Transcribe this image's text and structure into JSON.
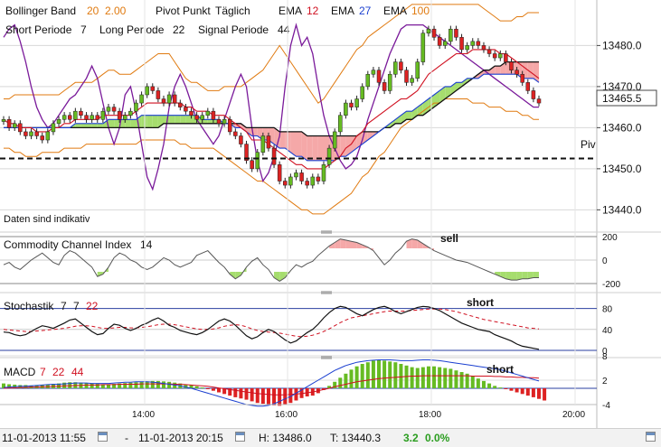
{
  "legend": {
    "bb_label": "Bollinger Band",
    "bb_p1": "20",
    "bb_p2": "2.00",
    "pivot_label": "Pivot Punkt",
    "pivot_freq": "Täglich",
    "ema_label": "EMA",
    "ema_p1": "12",
    "ema_p2": "27",
    "ema_p3": "100",
    "short_label": "Short Periode",
    "short_val": "7",
    "long_label": "Long Periode",
    "long_val": "22",
    "signal_label": "Signal Periode",
    "signal_val": "44",
    "note": "Daten sind indikativ",
    "pivot_tag": "Piv",
    "current_price": "13465.5"
  },
  "colors": {
    "bb": "#e07a10",
    "ema12": "#d01020",
    "ema27": "#1a3fd0",
    "ema100": "#111111",
    "signal": "#7a1a9a",
    "up": "#66bb22",
    "down": "#dd2222",
    "cloud_up": "#a6dd6e",
    "cloud_down": "#f5a8a8",
    "grid": "#d8d8d8"
  },
  "cci_panel": {
    "label": "Commodity Channel Index",
    "period": "14",
    "annotation": "sell",
    "ticks": [
      "200",
      "0",
      "-200"
    ]
  },
  "stoch_panel": {
    "label": "Stochastik",
    "p1": "7",
    "p2": "7",
    "p3": "22",
    "annotation": "short",
    "ticks": [
      "80",
      "40",
      "0"
    ]
  },
  "macd_panel": {
    "label": "MACD",
    "p1": "7",
    "p2": "22",
    "p3": "44",
    "annotation": "short",
    "ticks": [
      "8",
      "2",
      "-4"
    ]
  },
  "x_ticks": [
    "14:00",
    "16:00",
    "18:00",
    "20:00"
  ],
  "status": {
    "from": "11-01-2013 11:55",
    "dash": "-",
    "to": "11-01-2013 20:15",
    "high": "H: 13486.0",
    "low": "T: 13440.3",
    "change": "3.2",
    "change_pct": "0.0%"
  },
  "chart_data": {
    "type": "line",
    "title": "",
    "xlabel": "",
    "ylabel": "",
    "x_range": [
      "11:55",
      "20:15"
    ],
    "ylim": [
      13437,
      13488
    ],
    "y_ticks": [
      13440.0,
      13450.0,
      13460.0,
      13470.0,
      13480.0
    ],
    "y_tick_labels": [
      "13440.0",
      "13450.0",
      "13460.0",
      "13470.0",
      "13480.0"
    ],
    "pivot": 13452.5,
    "current_price": 13465.5,
    "candles_close": [
      13462,
      13460,
      13461,
      13459,
      13458,
      13459,
      13458,
      13457,
      13459,
      13461,
      13462,
      13463,
      13462,
      13464,
      13463,
      13462,
      13463,
      13462,
      13464,
      13465,
      13464,
      13462,
      13463,
      13464,
      13466,
      13468,
      13470,
      13469,
      13467,
      13466,
      13468,
      13466,
      13465,
      13464,
      13463,
      13462,
      13463,
      13464,
      13462,
      13461,
      13462,
      13459,
      13458,
      13456,
      13452,
      13450,
      13454,
      13458,
      13455,
      13451,
      13447,
      13446,
      13448,
      13449,
      13447,
      13446,
      13448,
      13447,
      13451,
      13455,
      13459,
      13463,
      13466,
      13465,
      13467,
      13470,
      13473,
      13474,
      13471,
      13469,
      13473,
      13476,
      13474,
      13471,
      13472,
      13476,
      13483,
      13484,
      13482,
      13480,
      13481,
      13484,
      13482,
      13479,
      13480,
      13481,
      13480,
      13479,
      13478,
      13477,
      13478,
      13476,
      13474,
      13473,
      13471,
      13469,
      13467,
      13466
    ],
    "bb_upper": [
      13467,
      13467,
      13468,
      13468,
      13468,
      13468,
      13468,
      13468,
      13468,
      13468,
      13468,
      13469,
      13470,
      13471,
      13471,
      13471,
      13471,
      13472,
      13473,
      13474,
      13474,
      13473,
      13473,
      13473,
      13474,
      13475,
      13476,
      13477,
      13478,
      13478,
      13478,
      13476,
      13474,
      13472,
      13471,
      13471,
      13470,
      13469,
      13469,
      13469,
      13470,
      13470,
      13470,
      13470,
      13471,
      13472,
      13473,
      13474,
      13476,
      13478,
      13480,
      13478,
      13476,
      13474,
      13472,
      13470,
      13468,
      13466,
      13467,
      13469,
      13471,
      13473,
      13475,
      13477,
      13479,
      13480,
      13482,
      13483,
      13484,
      13485,
      13486,
      13487,
      13488,
      13489,
      13490,
      13490,
      13490,
      13490,
      13490,
      13490,
      13490,
      13490,
      13490,
      13490,
      13490,
      13490,
      13490,
      13489,
      13488,
      13487,
      13486,
      13486,
      13486,
      13487,
      13487,
      13488,
      13488,
      13488
    ],
    "bb_lower": [
      13455,
      13455,
      13454,
      13454,
      13453,
      13453,
      13453,
      13454,
      13454,
      13454,
      13454,
      13455,
      13455,
      13455,
      13455,
      13456,
      13456,
      13456,
      13456,
      13456,
      13456,
      13456,
      13456,
      13456,
      13456,
      13457,
      13457,
      13457,
      13457,
      13457,
      13457,
      13457,
      13456,
      13456,
      13455,
      13455,
      13455,
      13455,
      13455,
      13454,
      13453,
      13452,
      13451,
      13450,
      13449,
      13448,
      13447,
      13447,
      13446,
      13445,
      13444,
      13443,
      13442,
      13441,
      13440,
      13440,
      13439,
      13439,
      13439,
      13440,
      13441,
      13442,
      13443,
      13444,
      13446,
      13448,
      13449,
      13451,
      13453,
      13454,
      13456,
      13458,
      13460,
      13461,
      13462,
      13463,
      13464,
      13465,
      13466,
      13466,
      13467,
      13467,
      13467,
      13467,
      13467,
      13466,
      13466,
      13466,
      13465,
      13465,
      13465,
      13464,
      13464,
      13464,
      13463,
      13463,
      13462,
      13462
    ],
    "ema12": [
      13462,
      13461,
      13461,
      13460,
      13460,
      13460,
      13459,
      13459,
      13459,
      13460,
      13460,
      13461,
      13461,
      13462,
      13462,
      13462,
      13462,
      13462,
      13463,
      13463,
      13463,
      13463,
      13463,
      13463,
      13464,
      13465,
      13466,
      13466,
      13466,
      13466,
      13466,
      13466,
      13466,
      13465,
      13465,
      13464,
      13464,
      13464,
      13463,
      13463,
      13463,
      13462,
      13461,
      13460,
      13459,
      13457,
      13457,
      13457,
      13456,
      13455,
      13454,
      13453,
      13452,
      13451,
      13451,
      13450,
      13450,
      13450,
      13450,
      13451,
      13452,
      13453,
      13455,
      13456,
      13458,
      13459,
      13461,
      13462,
      13463,
      13464,
      13465,
      13466,
      13467,
      13467,
      13468,
      13469,
      13471,
      13473,
      13474,
      13475,
      13476,
      13477,
      13478,
      13478,
      13478,
      13479,
      13479,
      13479,
      13479,
      13479,
      13478,
      13478,
      13477,
      13476,
      13475,
      13474,
      13473,
      13472
    ],
    "ema27": [
      13460,
      13460,
      13460,
      13460,
      13460,
      13460,
      13460,
      13460,
      13460,
      13460,
      13460,
      13460,
      13460,
      13461,
      13461,
      13461,
      13461,
      13461,
      13461,
      13462,
      13462,
      13462,
      13462,
      13462,
      13462,
      13463,
      13463,
      13463,
      13463,
      13463,
      13463,
      13463,
      13463,
      13463,
      13463,
      13463,
      13462,
      13462,
      13462,
      13462,
      13461,
      13461,
      13460,
      13460,
      13459,
      13458,
      13458,
      13457,
      13457,
      13456,
      13455,
      13455,
      13454,
      13453,
      13453,
      13452,
      13452,
      13452,
      13452,
      13452,
      13452,
      13453,
      13453,
      13454,
      13455,
      13456,
      13457,
      13458,
      13459,
      13460,
      13461,
      13462,
      13463,
      13464,
      13464,
      13465,
      13466,
      13467,
      13468,
      13469,
      13470,
      13470,
      13471,
      13471,
      13472,
      13472,
      13472,
      13473,
      13473,
      13473,
      13473,
      13473,
      13473,
      13473,
      13472,
      13472,
      13472,
      13471
    ],
    "ema100": [
      13460,
      13460,
      13460,
      13460,
      13460,
      13460,
      13460,
      13460,
      13460,
      13460,
      13460,
      13460,
      13460,
      13460,
      13460,
      13460,
      13460,
      13460,
      13460,
      13460,
      13460,
      13460,
      13460,
      13460,
      13460,
      13460,
      13460,
      13460,
      13460,
      13461,
      13461,
      13461,
      13461,
      13461,
      13461,
      13461,
      13461,
      13461,
      13461,
      13461,
      13461,
      13461,
      13461,
      13461,
      13460,
      13460,
      13460,
      13460,
      13460,
      13460,
      13459,
      13459,
      13459,
      13459,
      13459,
      13458,
      13458,
      13458,
      13458,
      13458,
      13458,
      13458,
      13458,
      13458,
      13458,
      13459,
      13459,
      13459,
      13459,
      13460,
      13460,
      13461,
      13461,
      13462,
      13462,
      13463,
      13463,
      13464,
      13465,
      13466,
      13467,
      13468,
      13469,
      13470,
      13471,
      13472,
      13473,
      13474,
      13474,
      13475,
      13475,
      13476,
      13476,
      13476,
      13476,
      13476,
      13476,
      13476
    ],
    "signal_line": [
      13482,
      13484,
      13485,
      13481,
      13476,
      13470,
      13465,
      13462,
      13460,
      13461,
      13463,
      13465,
      13467,
      13468,
      13470,
      13472,
      13475,
      13472,
      13466,
      13460,
      13456,
      13460,
      13468,
      13470,
      13464,
      13456,
      13448,
      13445,
      13450,
      13456,
      13465,
      13470,
      13473,
      13470,
      13466,
      13462,
      13460,
      13458,
      13456,
      13458,
      13462,
      13466,
      13470,
      13473,
      13470,
      13460,
      13452,
      13447,
      13449,
      13453,
      13458,
      13470,
      13480,
      13485,
      13480,
      13482,
      13478,
      13470,
      13463,
      13458,
      13455,
      13452,
      13450,
      13451,
      13453,
      13457,
      13462,
      13466,
      13470,
      13474,
      13478,
      13481,
      13484,
      13485,
      13485,
      13485,
      13485,
      13484,
      13483,
      13482,
      13481,
      13480,
      13479,
      13478,
      13477,
      13476,
      13475,
      13474,
      13473,
      13472,
      13471,
      13470,
      13469,
      13468,
      13467,
      13466,
      13465,
      13465
    ],
    "cci": [
      -40,
      -20,
      -60,
      -80,
      -40,
      0,
      30,
      60,
      20,
      -20,
      -40,
      40,
      80,
      60,
      20,
      -20,
      -60,
      -140,
      -120,
      -60,
      20,
      60,
      40,
      0,
      -20,
      -60,
      -80,
      -60,
      -20,
      20,
      0,
      -40,
      -60,
      -40,
      -20,
      40,
      60,
      80,
      30,
      -20,
      -60,
      -120,
      -160,
      -130,
      -60,
      -10,
      20,
      -40,
      -80,
      -150,
      -180,
      -150,
      -90,
      -40,
      -60,
      -30,
      -10,
      40,
      80,
      120,
      150,
      180,
      170,
      160,
      150,
      130,
      110,
      80,
      20,
      -40,
      0,
      60,
      100,
      160,
      180,
      170,
      140,
      110,
      80,
      60,
      40,
      20,
      0,
      -10,
      -20,
      -40,
      -60,
      -80,
      -100,
      -120,
      -140,
      -160,
      -170,
      -170,
      -160,
      -160,
      -150,
      -150
    ],
    "stoch_k": [
      35,
      34,
      30,
      28,
      30,
      36,
      42,
      47,
      45,
      42,
      47,
      52,
      58,
      60,
      52,
      44,
      36,
      30,
      32,
      42,
      50,
      48,
      42,
      38,
      42,
      48,
      52,
      58,
      62,
      56,
      48,
      44,
      38,
      35,
      32,
      30,
      34,
      40,
      48,
      56,
      60,
      56,
      48,
      38,
      28,
      22,
      26,
      34,
      40,
      36,
      28,
      20,
      14,
      18,
      26,
      34,
      40,
      50,
      62,
      72,
      80,
      84,
      82,
      76,
      70,
      66,
      72,
      78,
      82,
      84,
      80,
      74,
      70,
      74,
      78,
      82,
      84,
      83,
      80,
      76,
      70,
      64,
      58,
      52,
      48,
      44,
      40,
      38,
      36,
      30,
      26,
      22,
      18,
      12,
      8,
      6,
      4,
      2
    ],
    "stoch_d": [
      40,
      39,
      38,
      37,
      36,
      36,
      37,
      38,
      39,
      40,
      41,
      42,
      44,
      46,
      47,
      47,
      46,
      44,
      42,
      42,
      43,
      44,
      44,
      43,
      43,
      44,
      45,
      47,
      49,
      50,
      50,
      49,
      47,
      45,
      43,
      41,
      40,
      40,
      41,
      43,
      46,
      48,
      49,
      48,
      45,
      41,
      38,
      36,
      35,
      34,
      33,
      31,
      29,
      27,
      26,
      27,
      29,
      32,
      36,
      41,
      47,
      53,
      58,
      62,
      64,
      66,
      68,
      70,
      72,
      74,
      75,
      75,
      75,
      75,
      76,
      77,
      78,
      79,
      79,
      79,
      78,
      76,
      74,
      71,
      68,
      65,
      62,
      59,
      57,
      55,
      53,
      51,
      49,
      47,
      45,
      43,
      42,
      41
    ],
    "macd_hist": [
      1.2,
      1.0,
      0.9,
      0.8,
      0.8,
      0.7,
      0.8,
      0.9,
      1.0,
      1.1,
      1.2,
      1.4,
      1.5,
      1.5,
      1.4,
      1.3,
      1.2,
      1.1,
      1.0,
      1.0,
      1.1,
      1.2,
      1.3,
      1.4,
      1.5,
      1.6,
      1.7,
      1.8,
      1.8,
      1.7,
      1.6,
      1.4,
      1.2,
      1.0,
      0.8,
      0.5,
      0.2,
      -0.2,
      -0.6,
      -1.0,
      -1.4,
      -1.8,
      -2.2,
      -2.5,
      -2.8,
      -3.2,
      -3.6,
      -3.8,
      -4.0,
      -4.2,
      -4.3,
      -4.0,
      -3.6,
      -3.0,
      -2.4,
      -2.0,
      -1.8,
      -1.2,
      -0.4,
      0.6,
      1.6,
      2.6,
      3.6,
      4.6,
      5.4,
      6.0,
      6.4,
      6.8,
      7.0,
      6.8,
      6.6,
      6.4,
      6.0,
      5.6,
      5.2,
      5.0,
      5.2,
      5.4,
      5.4,
      5.2,
      5.0,
      4.8,
      4.4,
      4.0,
      3.6,
      3.0,
      2.4,
      1.8,
      1.2,
      0.6,
      0.2,
      -0.2,
      -0.6,
      -1.0,
      -1.4,
      -1.8,
      -2.2,
      -2.6,
      -3.0
    ],
    "macd_line": [
      0.2,
      0.3,
      0.4,
      0.5,
      0.5,
      0.6,
      0.7,
      0.8,
      0.9,
      1.0,
      1.0,
      1.1,
      1.2,
      1.3,
      1.3,
      1.3,
      1.2,
      1.2,
      1.2,
      1.2,
      1.3,
      1.4,
      1.5,
      1.5,
      1.6,
      1.6,
      1.6,
      1.5,
      1.4,
      1.2,
      1.0,
      0.8,
      0.6,
      0.3,
      0.0,
      -0.4,
      -0.8,
      -1.2,
      -1.6,
      -2.0,
      -2.4,
      -2.8,
      -3.2,
      -3.6,
      -4.0,
      -4.2,
      -4.4,
      -4.4,
      -4.2,
      -3.8,
      -3.2,
      -2.6,
      -2.0,
      -1.2,
      -0.4,
      0.4,
      1.2,
      2.0,
      2.8,
      3.6,
      4.4,
      5.0,
      5.6,
      6.0,
      6.4,
      6.6,
      6.8,
      6.9,
      7.0,
      7.0,
      7.0,
      6.9,
      6.8,
      6.8,
      6.8,
      6.9,
      7.0,
      7.0,
      6.9,
      6.8,
      6.6,
      6.4,
      6.2,
      6.0,
      5.8,
      5.6,
      5.4,
      5.2,
      5.0,
      4.8,
      4.6,
      4.2,
      3.8,
      3.4,
      3.0,
      2.6,
      2.2,
      1.8
    ],
    "macd_signal": [
      0.0,
      0.1,
      0.1,
      0.2,
      0.2,
      0.3,
      0.3,
      0.4,
      0.4,
      0.5,
      0.5,
      0.6,
      0.6,
      0.7,
      0.7,
      0.8,
      0.8,
      0.8,
      0.9,
      0.9,
      0.9,
      1.0,
      1.0,
      1.0,
      1.0,
      1.1,
      1.1,
      1.1,
      1.1,
      1.1,
      1.1,
      1.0,
      1.0,
      0.9,
      0.8,
      0.7,
      0.6,
      0.5,
      0.3,
      0.1,
      -0.1,
      -0.3,
      -0.5,
      -0.7,
      -0.9,
      -1.1,
      -1.3,
      -1.4,
      -1.5,
      -1.6,
      -1.6,
      -1.6,
      -1.5,
      -1.4,
      -1.3,
      -1.1,
      -0.9,
      -0.6,
      -0.3,
      0.0,
      0.4,
      0.7,
      1.0,
      1.3,
      1.6,
      1.8,
      2.0,
      2.2,
      2.4,
      2.5,
      2.6,
      2.7,
      2.8,
      2.9,
      3.0,
      3.0,
      3.1,
      3.1,
      3.1,
      3.1,
      3.1,
      3.1,
      3.1,
      3.1,
      3.1,
      3.0,
      3.0,
      3.0,
      3.0,
      2.9,
      2.9,
      2.8,
      2.8,
      2.7,
      2.7,
      2.6,
      2.6,
      2.5
    ]
  }
}
